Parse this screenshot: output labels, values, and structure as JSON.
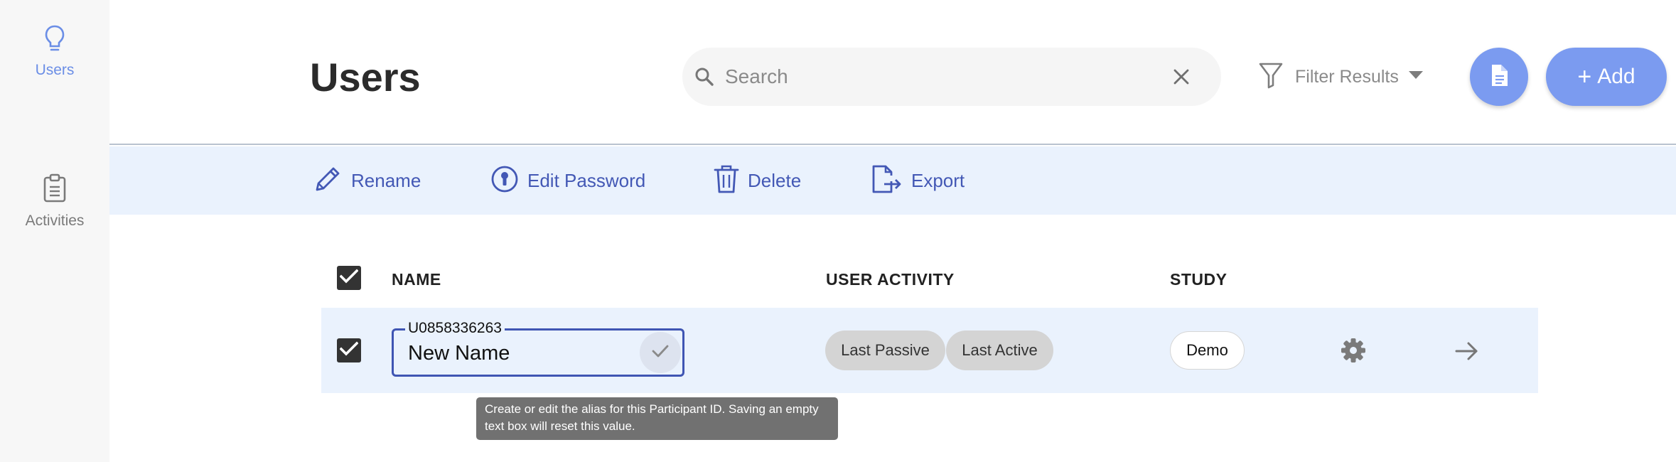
{
  "sidebar": {
    "items": [
      {
        "label": "Users",
        "icon": "lightbulb-icon",
        "active": true
      },
      {
        "label": "Activities",
        "icon": "clipboard-icon",
        "active": false
      }
    ]
  },
  "header": {
    "title": "Users",
    "search": {
      "placeholder": "Search",
      "value": ""
    },
    "filter_label": "Filter Results",
    "add_label": "Add"
  },
  "toolbar": {
    "rename": "Rename",
    "edit_password": "Edit Password",
    "delete": "Delete",
    "export": "Export"
  },
  "table": {
    "columns": [
      "NAME",
      "USER ACTIVITY",
      "STUDY"
    ],
    "rows": [
      {
        "participant_id": "U0858336263",
        "name_value": "New Name",
        "activity": [
          "Last Passive",
          "Last Active"
        ],
        "study": "Demo",
        "selected": true
      }
    ]
  },
  "tooltip": "Create or edit the alias for this Participant ID. Saving an empty text box will reset this value.",
  "colors": {
    "accent": "#7b9bf0",
    "toolbar_bg": "#eaf2fd",
    "toolbar_text": "#4358b5",
    "sidebar_active": "#6b8ee6"
  }
}
